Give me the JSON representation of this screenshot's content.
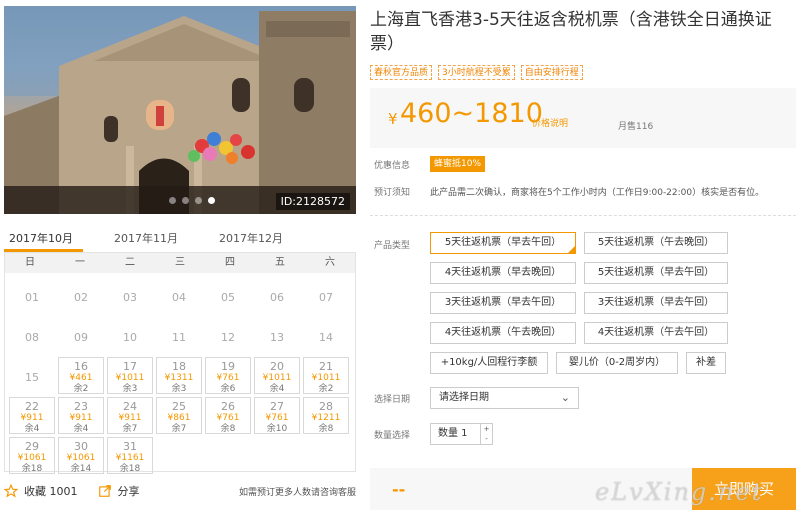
{
  "photo": {
    "id_label": "ID:2128572",
    "dots": 4,
    "active_dot": 3
  },
  "calendar": {
    "months": [
      "2017年10月",
      "2017年11月",
      "2017年12月"
    ],
    "active_month": 0,
    "weekdays": [
      "日",
      "一",
      "二",
      "三",
      "四",
      "五",
      "六"
    ],
    "days": [
      {
        "d": "01"
      },
      {
        "d": "02"
      },
      {
        "d": "03"
      },
      {
        "d": "04"
      },
      {
        "d": "05"
      },
      {
        "d": "06"
      },
      {
        "d": "07"
      },
      {
        "d": "08"
      },
      {
        "d": "09"
      },
      {
        "d": "10"
      },
      {
        "d": "11"
      },
      {
        "d": "12"
      },
      {
        "d": "13"
      },
      {
        "d": "14"
      },
      {
        "d": "15"
      },
      {
        "d": "16",
        "p": "¥461",
        "r": "余2"
      },
      {
        "d": "17",
        "p": "¥1011",
        "r": "余3"
      },
      {
        "d": "18",
        "p": "¥1311",
        "r": "余3"
      },
      {
        "d": "19",
        "p": "¥761",
        "r": "余6"
      },
      {
        "d": "20",
        "p": "¥1011",
        "r": "余4"
      },
      {
        "d": "21",
        "p": "¥1011",
        "r": "余2"
      },
      {
        "d": "22",
        "p": "¥911",
        "r": "余4"
      },
      {
        "d": "23",
        "p": "¥911",
        "r": "余4"
      },
      {
        "d": "24",
        "p": "¥911",
        "r": "余7"
      },
      {
        "d": "25",
        "p": "¥861",
        "r": "余7"
      },
      {
        "d": "26",
        "p": "¥761",
        "r": "余8"
      },
      {
        "d": "27",
        "p": "¥761",
        "r": "余10"
      },
      {
        "d": "28",
        "p": "¥1211",
        "r": "余8"
      },
      {
        "d": "29",
        "p": "¥1061",
        "r": "余18"
      },
      {
        "d": "30",
        "p": "¥1061",
        "r": "余14"
      },
      {
        "d": "31",
        "p": "¥1161",
        "r": "余18"
      }
    ]
  },
  "actions": {
    "favorite": "收藏 1001",
    "share": "分享",
    "note": "如需预订更多人数请咨询客服"
  },
  "product": {
    "title": "上海直飞香港3-5天往返含税机票（含港铁全日通换证票）",
    "tags": [
      "春秋官方品质",
      "3小时航程不受累",
      "自由安排行程"
    ],
    "currency": "¥",
    "price_range": "460~1810",
    "price_link": "价格说明",
    "sales": "月售116"
  },
  "info": {
    "discount_label": "优惠信息",
    "discount_badge": "蜂蜜抵10%",
    "notice_label": "预订须知",
    "notice_text": "此产品需二次确认，商家将在5个工作小时内（工作日9:00-22:00）核实是否有位。"
  },
  "options": {
    "label": "产品类型",
    "items": [
      "5天往返机票（早去午回）",
      "5天往返机票（午去晚回）",
      "4天往返机票（早去晚回）",
      "5天往返机票（早去午回）",
      "3天往返机票（早去午回）",
      "3天往返机票（早去午回）",
      "4天往返机票（午去晚回）",
      "4天往返机票（午去午回）",
      "+10kg/人回程行李额",
      "婴儿价（0-2周岁内）",
      "补差"
    ],
    "selected": 0
  },
  "date": {
    "label": "选择日期",
    "placeholder": "请选择日期"
  },
  "quantity": {
    "label": "数量选择",
    "value": "数量  1"
  },
  "buy": {
    "price": "--",
    "button": "立即购买"
  },
  "watermark": "eLvXing.net",
  "colors": {
    "accent": "#f39800",
    "button": "#f7a11a"
  }
}
